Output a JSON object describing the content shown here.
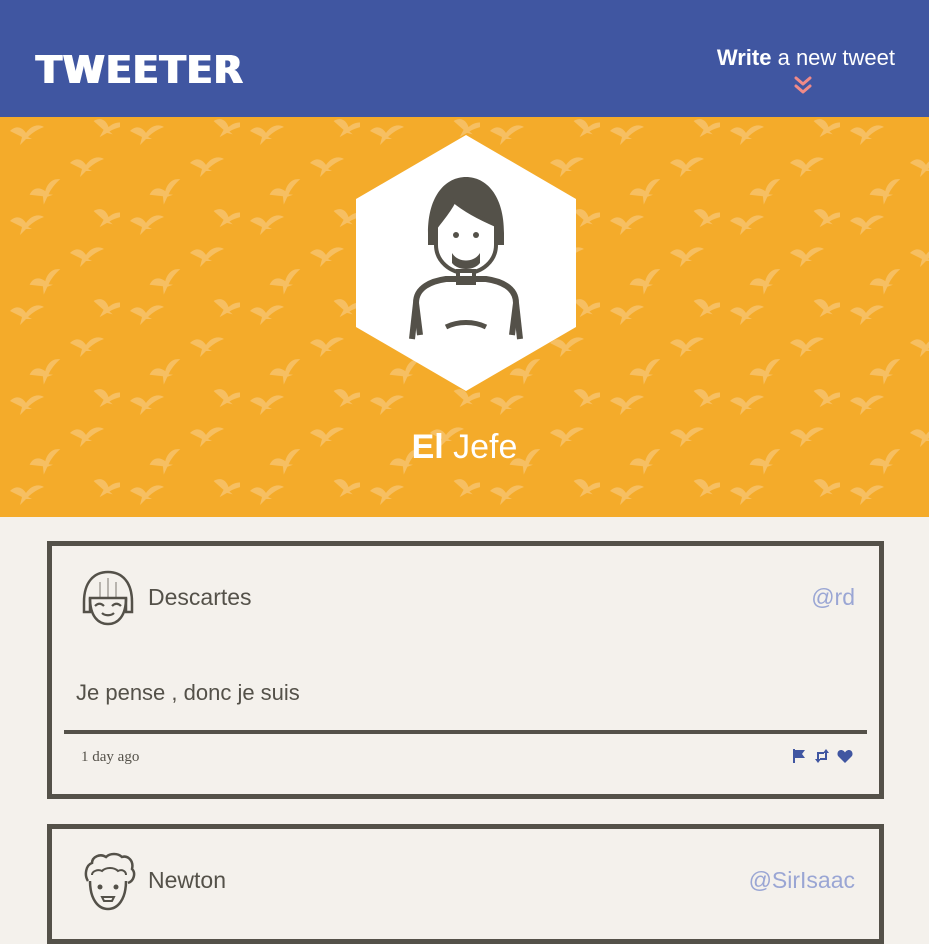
{
  "nav": {
    "logo": "TWEETER",
    "compose_bold": "Write",
    "compose_rest": " a new tweet",
    "chevron_icon": "double-chevron-down-icon",
    "chevron_color": "#f08a88"
  },
  "profile": {
    "name_bold": "El",
    "name_rest": " Jefe"
  },
  "colors": {
    "nav_bg": "#4056a1",
    "hero_bg": "#f4ab2a",
    "page_bg": "#f4f1ec",
    "ink": "#545149",
    "handle": "#9aa6d4",
    "action_icons": "#4056a1"
  },
  "tweets": [
    {
      "name": "Descartes",
      "handle": "@rd",
      "content": "Je pense , donc je suis",
      "time": "1 day ago",
      "actions": [
        "flag-icon",
        "retweet-icon",
        "heart-icon"
      ]
    },
    {
      "name": "Newton",
      "handle": "@SirIsaac"
    }
  ]
}
